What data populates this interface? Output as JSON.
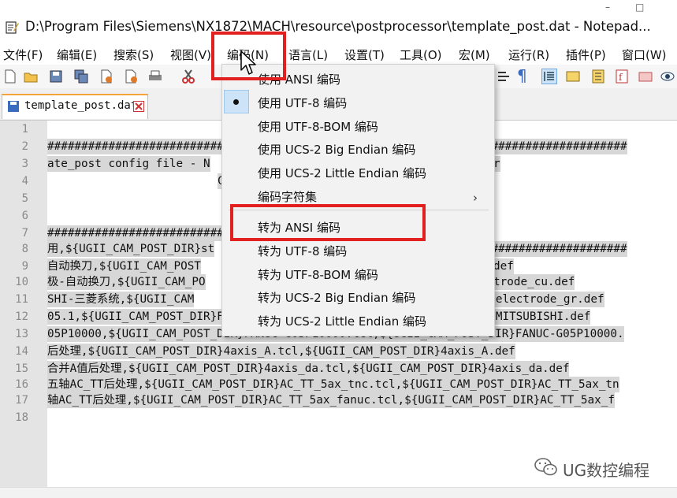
{
  "window": {
    "title": "D:\\Program Files\\Siemens\\NX1872\\MACH\\resource\\postprocessor\\template_post.dat - Notepad...",
    "controls": [
      "–",
      "□"
    ]
  },
  "menubar": {
    "items": [
      "文件(F)",
      "编辑(E)",
      "搜索(S)",
      "视图(V)",
      "编码(N)",
      "语言(L)",
      "设置(T)",
      "工具(O)",
      "宏(M)",
      "运行(R)",
      "插件(P)",
      "窗口(W)"
    ]
  },
  "toolbar": {
    "icons": [
      "new-file-icon",
      "open-file-icon",
      "save-icon",
      "save-all-icon",
      "close-icon",
      "close-all-icon",
      "print-icon",
      "cut-icon",
      "show-all-chars-icon",
      "pilcrow-icon",
      "indent-guide-icon",
      "wrap-icon",
      "doc-map-icon",
      "function-list-icon",
      "folder-icon",
      "monitor-icon"
    ]
  },
  "tab": {
    "label": "template_post.dat"
  },
  "editor": {
    "line_numbers": [
      "1",
      "2",
      "3",
      "4",
      "5",
      "6",
      "7",
      "8",
      "9",
      "10",
      "11",
      "12",
      "13",
      "14",
      "15",
      "16",
      "17",
      "18"
    ],
    "lines": [
      "",
      "###########################",
      "ate_post config file - N",
      "",
      "",
      "",
      "###########################",
      "用,${UGII_CAM_POST_DIR}st",
      "自动换刀,${UGII_CAM_POST",
      "极-自动换刀,${UGII_CAM_PO",
      "SHI-三菱系统,${UGII_CAM",
      "05.1,${UGII_CAM_POST_DIR}FANUC-G05.1.tcl,${UGII_CAM_POST_DIR}FANUC-G05.1.def",
      "05P10000,${UGII_CAM_POST_DIR}FANUC-G05P10000.tcl,${UGII_CAM_POST_DIR}FANUC-G05P10000.",
      "后处理,${UGII_CAM_POST_DIR}4axis_A.tcl,${UGII_CAM_POST_DIR}4axis_A.def",
      "合并A值后处理,${UGII_CAM_POST_DIR}4axis_da.tcl,${UGII_CAM_POST_DIR}4axis_da.def",
      "五轴AC_TT后处理,${UGII_CAM_POST_DIR}AC_TT_5ax_tnc.tcl,${UGII_CAM_POST_DIR}AC_TT_5ax_tn",
      "轴AC_TT后处理,${UGII_CAM_POST_DIR}AC_TT_5ax_fanuc.tcl,${UGII_CAM_POST_DIR}AC_TT_5ax_f"
    ],
    "right_fragments": [
      {
        "line": 2,
        "text": "#############################"
      },
      {
        "line": 3,
        "text": "r"
      },
      {
        "line": 4,
        "text": ""
      },
      {
        "line": 8,
        "text": "#############################"
      },
      {
        "line": 9,
        "text": "def"
      },
      {
        "line": 10,
        "text": "T_DIR}electrode_cu.def"
      },
      {
        "line": 11,
        "text": "OST_DIR}electrode_gr.def"
      },
      {
        "line": 12,
        "text": "OST_DIR}MITSUBISHI.def"
      }
    ],
    "line4_mid": "C"
  },
  "encoding_menu": {
    "items": [
      "使用 ANSI 编码",
      "使用 UTF-8 编码",
      "使用 UTF-8-BOM 编码",
      "使用 UCS-2 Big Endian 编码",
      "使用 UCS-2 Little Endian 编码",
      "编码字符集",
      "转为 ANSI 编码",
      "转为 UTF-8 编码",
      "转为 UTF-8-BOM 编码",
      "转为 UCS-2 Big Endian 编码",
      "转为 UCS-2 Little Endian 编码"
    ],
    "checked_item": "使用 UTF-8 编码",
    "submenu_arrow": "›"
  },
  "watermark": {
    "text": "UG数控编程"
  },
  "colors": {
    "highlight_red": "#e22020",
    "selection_gray": "#d7d7d7",
    "gutter_gray": "#e4e4e4",
    "tab_accent": "#f4a43a"
  }
}
